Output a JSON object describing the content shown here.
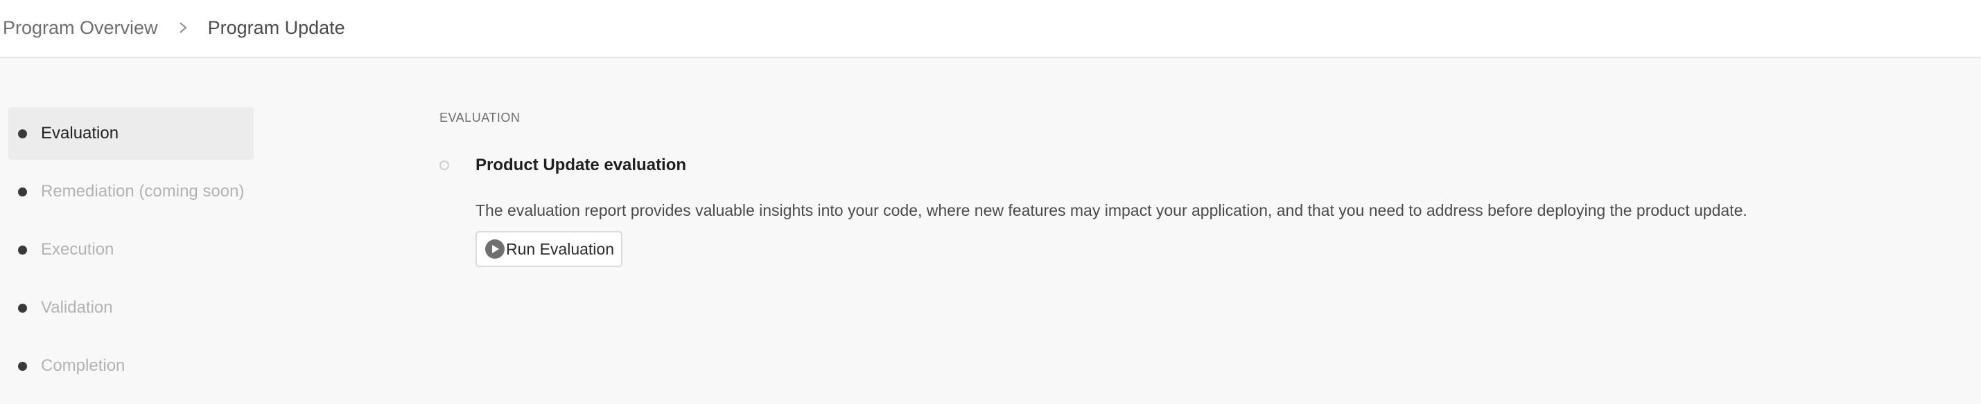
{
  "breadcrumb": {
    "parent": "Program Overview",
    "separator_icon": "chevron-right-icon",
    "current": "Program Update"
  },
  "steps": [
    {
      "label": "Evaluation",
      "state": "active"
    },
    {
      "label": "Remediation (coming soon)",
      "state": "disabled"
    },
    {
      "label": "Execution",
      "state": "disabled"
    },
    {
      "label": "Validation",
      "state": "disabled"
    },
    {
      "label": "Completion",
      "state": "disabled"
    }
  ],
  "main": {
    "section_label": "EVALUATION",
    "title": "Product Update evaluation",
    "description": "The evaluation report provides valuable insights into your code, where new features may impact your application, and that you need to address before deploying the product update.",
    "run_button": {
      "label": "Run Evaluation",
      "icon": "play-circle-icon"
    }
  },
  "colors": {
    "background": "#f8f8f8",
    "header_background": "#ffffff",
    "active_step_background": "#ececec",
    "disabled_text": "#b3b3b3"
  }
}
